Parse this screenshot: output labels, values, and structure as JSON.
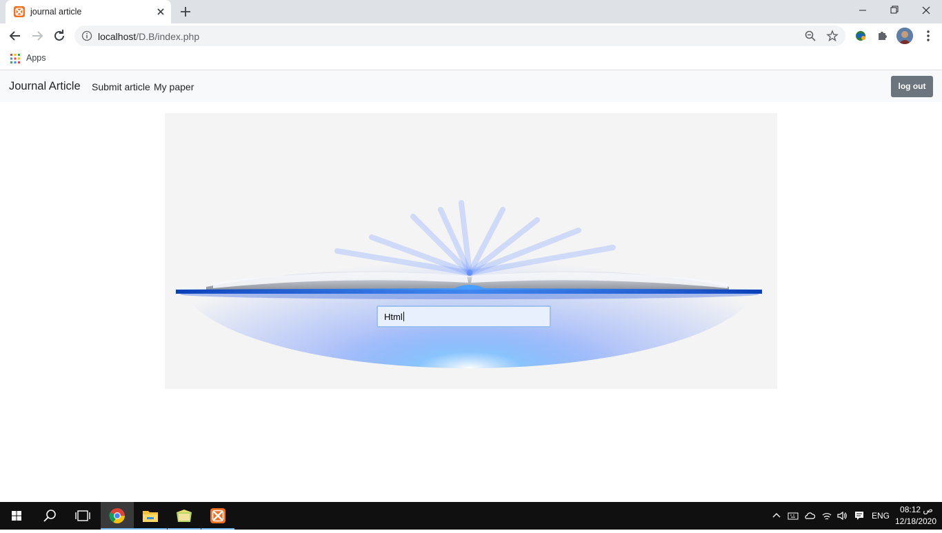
{
  "browser": {
    "tab_title": "journal article",
    "url_host": "localhost",
    "url_path": "/D.B/index.php",
    "bookmarks": {
      "apps_label": "Apps"
    }
  },
  "navbar": {
    "brand": "Journal Article",
    "links": [
      "Submit article",
      "My paper"
    ],
    "logout_label": "log out"
  },
  "hero": {
    "search_value": "Html"
  },
  "taskbar": {
    "language": "ENG",
    "time": "08:12 ص",
    "date": "12/18/2020"
  },
  "colors": {
    "navbar_bg": "#f8f9fa",
    "logout_bg": "#6c757d",
    "book_glow": "#3a7bff",
    "input_bg": "#e8f0fe"
  }
}
